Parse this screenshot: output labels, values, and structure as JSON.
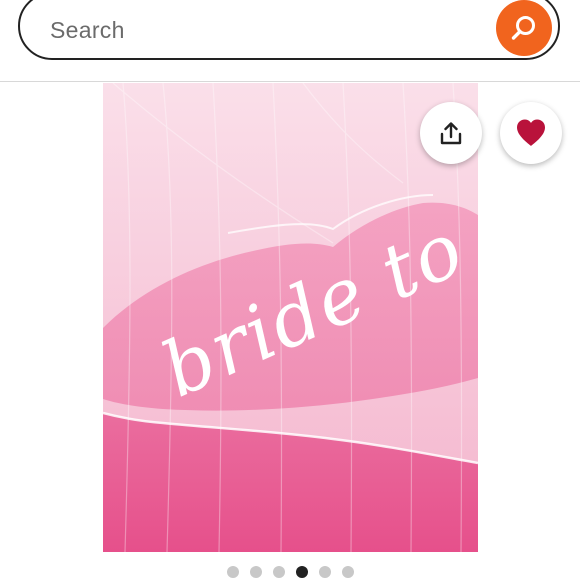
{
  "search": {
    "placeholder": "Search",
    "button_icon": "search-icon",
    "button_color": "#f1641e"
  },
  "product_image": {
    "embroidered_text": "bride to",
    "background_color": "#e85a94",
    "veil_color": "#f6c8da"
  },
  "actions": {
    "share_icon": "share-icon",
    "favorite_icon": "heart-icon",
    "favorite_color": "#b9123b"
  },
  "carousel": {
    "total_images": 6,
    "active_index": 4
  }
}
